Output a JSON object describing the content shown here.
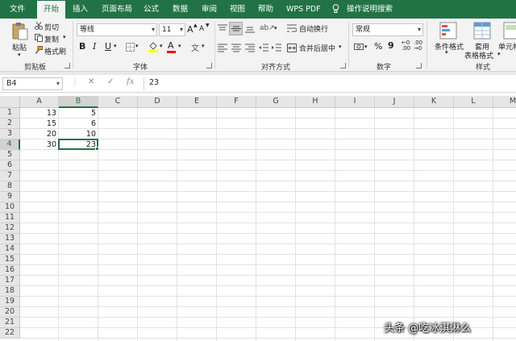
{
  "tabs": [
    "文件",
    "开始",
    "插入",
    "页面布局",
    "公式",
    "数据",
    "审阅",
    "视图",
    "帮助",
    "WPS PDF",
    "操作说明搜索"
  ],
  "active_tab": "开始",
  "clipboard": {
    "paste": "粘贴",
    "cut": "剪切",
    "copy": "复制",
    "format_painter": "格式刷",
    "label": "剪贴板"
  },
  "font": {
    "name": "等线",
    "size": "11",
    "bold": "B",
    "italic": "I",
    "underline": "U",
    "grow": "A",
    "shrink": "A",
    "wen": "文",
    "label": "字体",
    "fill_color": "#ffff00",
    "font_color": "#ff0000"
  },
  "alignment": {
    "wrap_text": "自动换行",
    "merge_center": "合并后居中",
    "label": "对齐方式"
  },
  "number": {
    "format": "常规",
    "percent": "%",
    "comma": "9",
    "label": "数字"
  },
  "styles": {
    "conditional": "条件格式",
    "table_format_1": "套用",
    "table_format_2": "表格格式",
    "cell_styles": "单元格",
    "label": "样式"
  },
  "formula_bar": {
    "name_box": "B4",
    "fx": "fx",
    "value": "23"
  },
  "sheet": {
    "columns": [
      "A",
      "B",
      "C",
      "D",
      "E",
      "F",
      "G",
      "H",
      "I",
      "J",
      "K",
      "L",
      "M"
    ],
    "rows": [
      "1",
      "2",
      "3",
      "4",
      "5",
      "6",
      "7",
      "8",
      "9",
      "10",
      "11",
      "12",
      "13",
      "14",
      "15",
      "16",
      "17",
      "18",
      "19",
      "20",
      "21",
      "22"
    ],
    "selected_cell": "B4",
    "selected_column": "B",
    "selected_row": "4",
    "cells": [
      {
        "col": "A",
        "row": "1",
        "value": "13"
      },
      {
        "col": "B",
        "row": "1",
        "value": "5"
      },
      {
        "col": "A",
        "row": "2",
        "value": "15"
      },
      {
        "col": "B",
        "row": "2",
        "value": "6"
      },
      {
        "col": "A",
        "row": "3",
        "value": "20"
      },
      {
        "col": "B",
        "row": "3",
        "value": "10"
      },
      {
        "col": "A",
        "row": "4",
        "value": "30"
      },
      {
        "col": "B",
        "row": "4",
        "value": "23"
      }
    ]
  },
  "watermark": "头条 @吃冰淇淋么",
  "colors": {
    "accent": "#217346",
    "grid": "#e2e2e2",
    "header_bg": "#e6e6e6"
  }
}
